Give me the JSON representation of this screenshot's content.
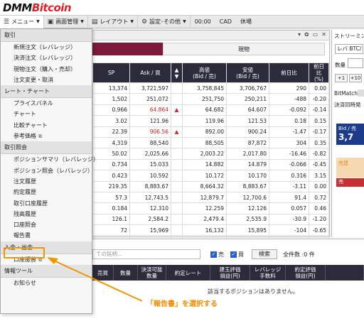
{
  "brand": {
    "part1": "DMM",
    "part2": "Bitcoin"
  },
  "menubar": {
    "menu": "メニュー",
    "screen": "画面管理",
    "layout": "レイアウト",
    "settings": "設定･その他",
    "time": "00:00",
    "cad": "CAD",
    "status": "休場"
  },
  "tabs": {
    "spot": "現物"
  },
  "rate_table": {
    "headers": [
      "SP",
      "Ask / 買",
      "",
      "高値\n(Bid / 売)",
      "安値\n(Bid / 売)",
      "前日比",
      "前日比\n(%)"
    ],
    "rows": [
      {
        "sp": "13,374",
        "ask": "3,721,597",
        "tri": "",
        "high": "3,758,845",
        "low": "3,706,767",
        "chg": "290",
        "pct": "0.00"
      },
      {
        "sp": "1,502",
        "ask": "251,072",
        "tri": "",
        "high": "251,750",
        "low": "250,211",
        "chg": "-488",
        "pct": "-0.20"
      },
      {
        "sp": "0.966",
        "ask": "64.864",
        "tri": "▲",
        "high": "64.682",
        "low": "64.607",
        "chg": "-0.092",
        "pct": "-0.14"
      },
      {
        "sp": "3.02",
        "ask": "121.96",
        "tri": "",
        "high": "119.96",
        "low": "121.53",
        "chg": "0.18",
        "pct": "0.15"
      },
      {
        "sp": "22.39",
        "ask": "906.56",
        "tri": "▲",
        "high": "892.00",
        "low": "900.24",
        "chg": "-1.47",
        "pct": "-0.17"
      },
      {
        "sp": "4,319",
        "ask": "88,540",
        "tri": "",
        "high": "88,505",
        "low": "87,872",
        "chg": "304",
        "pct": "0.35"
      },
      {
        "sp": "50.02",
        "ask": "2,025.66",
        "tri": "",
        "high": "2,003.22",
        "low": "2,017.80",
        "chg": "-16.46",
        "pct": "-0.82"
      },
      {
        "sp": "0.734",
        "ask": "15.033",
        "tri": "",
        "high": "14.882",
        "low": "14.879",
        "chg": "-0.066",
        "pct": "-0.45"
      },
      {
        "sp": "0.423",
        "ask": "10.592",
        "tri": "",
        "high": "10.172",
        "low": "10.170",
        "chg": "0.316",
        "pct": "3.15"
      },
      {
        "sp": "219.35",
        "ask": "8,883.67",
        "tri": "",
        "high": "8,664.32",
        "low": "8,883.67",
        "chg": "-3.11",
        "pct": "0.00"
      },
      {
        "sp": "57.3",
        "ask": "12,743.5",
        "tri": "",
        "high": "12,879.7",
        "low": "12,700.6",
        "chg": "91.4",
        "pct": "0.72"
      },
      {
        "sp": "0.184",
        "ask": "12.310",
        "tri": "",
        "high": "12.259",
        "low": "12.126",
        "chg": "0.057",
        "pct": "0.46"
      },
      {
        "sp": "126.1",
        "ask": "2,584.2",
        "tri": "",
        "high": "2,479.4",
        "low": "2,535.9",
        "chg": "-30.9",
        "pct": "-1.20"
      },
      {
        "sp": "72",
        "ask": "15,969",
        "tri": "",
        "high": "16,132",
        "low": "15,895",
        "chg": "-104",
        "pct": "-0.65"
      },
      {
        "sp": "0.455",
        "ask": "30.522",
        "tri": "",
        "high": "30.437",
        "low": "30.357",
        "chg": "-0.072",
        "pct": "-0.24"
      }
    ]
  },
  "right_panel": {
    "title": "ストリーミング",
    "pair_select": "レバ BTC/",
    "qty_label": "数量",
    "plus1": "+1",
    "plus10": "+10",
    "bitmatch": "BitMatch",
    "simul": "決済同時発",
    "bid_label": "Bid / 売",
    "bid_value": "3,7",
    "ask_label": "売建",
    "ask_label2": "売"
  },
  "lower": {
    "filter_placeholder": "ての銘柄...",
    "chk_sell": "売",
    "chk_buy": "買",
    "search": "検索",
    "count": "全件数 :0 件",
    "headers": [
      "売買",
      "数量",
      "決済可能\n数量",
      "約定レート",
      "建玉評価\n損益(円)",
      "レバレッジ\n手数料",
      "約定評価\n損益(円)"
    ],
    "empty": "該当するポジションはありません。"
  },
  "menu": {
    "sections": [
      {
        "title": "取引",
        "items": [
          {
            "label": "新規注文（レバレッジ）",
            "ext": false
          },
          {
            "label": "決済注文（レバレッジ）",
            "ext": false
          },
          {
            "label": "現物注文（購入・売却）",
            "ext": false
          },
          {
            "label": "注文変更・取消",
            "ext": false
          }
        ]
      },
      {
        "title": "レート・チャート",
        "items": [
          {
            "label": "プライスパネル",
            "ext": false
          },
          {
            "label": "チャート",
            "ext": false
          },
          {
            "label": "比較チャート",
            "ext": false
          },
          {
            "label": "参考価格",
            "ext": true
          }
        ]
      },
      {
        "title": "取引照会",
        "items": [
          {
            "label": "ポジションサマリ（レバレッジ）",
            "ext": false
          },
          {
            "label": "ポジション照会（レバレッジ）",
            "ext": false
          },
          {
            "label": "注文履歴",
            "ext": false
          },
          {
            "label": "約定履歴",
            "ext": false
          },
          {
            "label": "取引口座履歴",
            "ext": false
          },
          {
            "label": "残高履歴",
            "ext": false
          },
          {
            "label": "口座照会",
            "ext": false
          },
          {
            "label": "報告書",
            "ext": false
          }
        ]
      },
      {
        "title": "入金・出金",
        "items": [
          {
            "label": "口座振替",
            "ext": true
          }
        ]
      },
      {
        "title": "情報ツール",
        "items": [
          {
            "label": "お知らせ",
            "ext": false
          }
        ]
      }
    ]
  },
  "annotation": {
    "text": "「報告書」を選択する",
    "color": "#f08c00"
  }
}
